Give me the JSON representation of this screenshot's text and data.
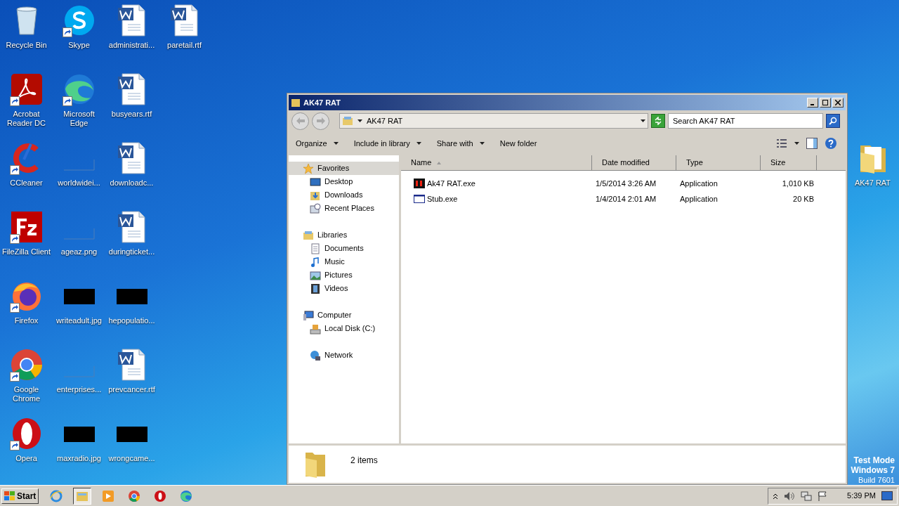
{
  "desktop": {
    "columns": [
      [
        {
          "label": "Recycle Bin",
          "kind": "recycle",
          "shortcut": false
        },
        {
          "label": "Acrobat Reader DC",
          "kind": "acrobat",
          "shortcut": true
        },
        {
          "label": "CCleaner",
          "kind": "ccleaner",
          "shortcut": true
        },
        {
          "label": "FileZilla Client",
          "kind": "filezilla",
          "shortcut": true
        },
        {
          "label": "Firefox",
          "kind": "firefox",
          "shortcut": true
        },
        {
          "label": "Google Chrome",
          "kind": "chrome",
          "shortcut": true
        },
        {
          "label": "Opera",
          "kind": "opera",
          "shortcut": true
        }
      ],
      [
        {
          "label": "Skype",
          "kind": "skype",
          "shortcut": true
        },
        {
          "label": "Microsoft Edge",
          "kind": "edge",
          "shortcut": true
        },
        {
          "label": "worldwidei...",
          "kind": "blank",
          "shortcut": false
        },
        {
          "label": "ageaz.png",
          "kind": "blank",
          "shortcut": false
        },
        {
          "label": "writeadult.jpg",
          "kind": "dark",
          "shortcut": false
        },
        {
          "label": "enterprises...",
          "kind": "blank",
          "shortcut": false
        },
        {
          "label": "maxradio.jpg",
          "kind": "dark",
          "shortcut": false
        }
      ],
      [
        {
          "label": "administrati...",
          "kind": "word",
          "shortcut": false
        },
        {
          "label": "busyears.rtf",
          "kind": "word",
          "shortcut": false
        },
        {
          "label": "downloadc...",
          "kind": "word",
          "shortcut": false
        },
        {
          "label": "duringticket...",
          "kind": "word",
          "shortcut": false
        },
        {
          "label": "hepopulatio...",
          "kind": "dark",
          "shortcut": false
        },
        {
          "label": "prevcancer.rtf",
          "kind": "word",
          "shortcut": false
        },
        {
          "label": "wrongcame...",
          "kind": "dark",
          "shortcut": false
        }
      ],
      [
        {
          "label": "paretail.rtf",
          "kind": "word",
          "shortcut": false
        }
      ]
    ],
    "right_icons": [
      {
        "label": "AK47 RAT",
        "kind": "folder",
        "shortcut": false
      }
    ],
    "test_mode": [
      "Test Mode",
      "Windows 7",
      "Build 7601"
    ]
  },
  "window": {
    "title": "AK47 RAT",
    "address": "AK47 RAT",
    "search": {
      "placeholder": "Search AK47 RAT"
    },
    "toolbar": [
      {
        "label": "Organize",
        "dropdown": true
      },
      {
        "label": "Include in library",
        "dropdown": true
      },
      {
        "label": "Share with",
        "dropdown": true
      },
      {
        "label": "New folder",
        "dropdown": false
      }
    ],
    "nav": [
      {
        "label": "Favorites",
        "kind": "star",
        "selected": true,
        "children": [
          {
            "label": "Desktop",
            "kind": "desktop",
            "selected": false
          },
          {
            "label": "Downloads",
            "kind": "downloads",
            "selected": false
          },
          {
            "label": "Recent Places",
            "kind": "recent",
            "selected": false
          }
        ]
      },
      {
        "label": "Libraries",
        "kind": "libraries",
        "selected": false,
        "children": [
          {
            "label": "Documents",
            "kind": "documents",
            "selected": false
          },
          {
            "label": "Music",
            "kind": "music",
            "selected": false
          },
          {
            "label": "Pictures",
            "kind": "pictures",
            "selected": false
          },
          {
            "label": "Videos",
            "kind": "videos",
            "selected": false
          }
        ]
      },
      {
        "label": "Computer",
        "kind": "computer",
        "selected": false,
        "children": [
          {
            "label": "Local Disk (C:)",
            "kind": "disk",
            "selected": false
          }
        ]
      },
      {
        "label": "Network",
        "kind": "network",
        "selected": false
      }
    ],
    "columns": [
      {
        "label": "Name",
        "sorted": true
      },
      {
        "label": "Date modified",
        "sorted": false
      },
      {
        "label": "Type",
        "sorted": false
      },
      {
        "label": "Size",
        "sorted": false
      }
    ],
    "files": [
      {
        "name": "Ak47 RAT.exe",
        "kind": "rat",
        "date": "1/5/2014 3:26 AM",
        "type": "Application",
        "size": "1,010 KB"
      },
      {
        "name": "Stub.exe",
        "kind": "exe",
        "date": "1/4/2014 2:01 AM",
        "type": "Application",
        "size": "20 KB"
      }
    ],
    "status": "2 items"
  },
  "taskbar": {
    "start": "Start",
    "apps": [
      {
        "kind": "ie",
        "active": false
      },
      {
        "kind": "explorer",
        "active": true
      },
      {
        "kind": "media",
        "active": false
      },
      {
        "kind": "chrome",
        "active": false
      },
      {
        "kind": "opera",
        "active": false
      },
      {
        "kind": "edge",
        "active": false
      }
    ],
    "clock": "5:39 PM"
  }
}
